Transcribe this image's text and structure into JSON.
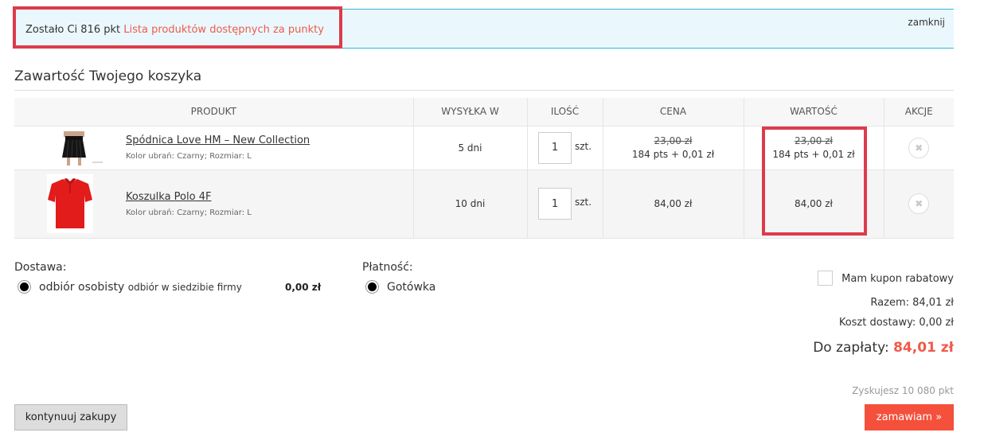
{
  "notice": {
    "text": "Zostało Ci 816 pkt",
    "link": "Lista produktów dostępnych za punkty",
    "close": "zamknij"
  },
  "cart": {
    "title": "Zawartość Twojego koszyka",
    "headers": [
      "Produkt",
      "Wysyłka w",
      "Ilość",
      "Cena",
      "Wartość",
      "Akcje"
    ],
    "items": [
      {
        "name": "Spódnica Love HM – New Collection",
        "attrs": "Kolor ubrań: Czarny; Rozmiar: L",
        "shipping": "5 dni",
        "qty": "1",
        "unit": "szt.",
        "price_old": "23,00 zł",
        "price": "184 pts + 0,01 zł",
        "value_old": "23,00 zł",
        "value": "184 pts + 0,01 zł"
      },
      {
        "name": "Koszulka Polo 4F",
        "attrs": "Kolor ubrań: Czarny; Rozmiar: L",
        "shipping": "10 dni",
        "qty": "1",
        "unit": "szt.",
        "price": "84,00 zł",
        "value": "84,00 zł"
      }
    ]
  },
  "delivery": {
    "label": "Dostawa:",
    "option": "odbiór osobisty",
    "option_sub": "odbiór w siedzibie firmy",
    "price": "0,00 zł"
  },
  "payment": {
    "label": "Płatność:",
    "option": "Gotówka"
  },
  "summary": {
    "coupon": "Mam kupon rabatowy",
    "subtotal": "Razem: 84,01 zł",
    "shipping_cost": "Koszt dostawy: 0,00 zł",
    "total_label": "Do zapłaty:",
    "total_value": "84,01 zł",
    "points_earned": "Zyskujesz 10 080 pkt"
  },
  "buttons": {
    "continue": "kontynuuj zakupy",
    "order": "zamawiam »"
  },
  "colors": {
    "accent": "#ef5a4a",
    "highlight": "#dd3b4b",
    "notice_bg": "#eaf8fe"
  }
}
